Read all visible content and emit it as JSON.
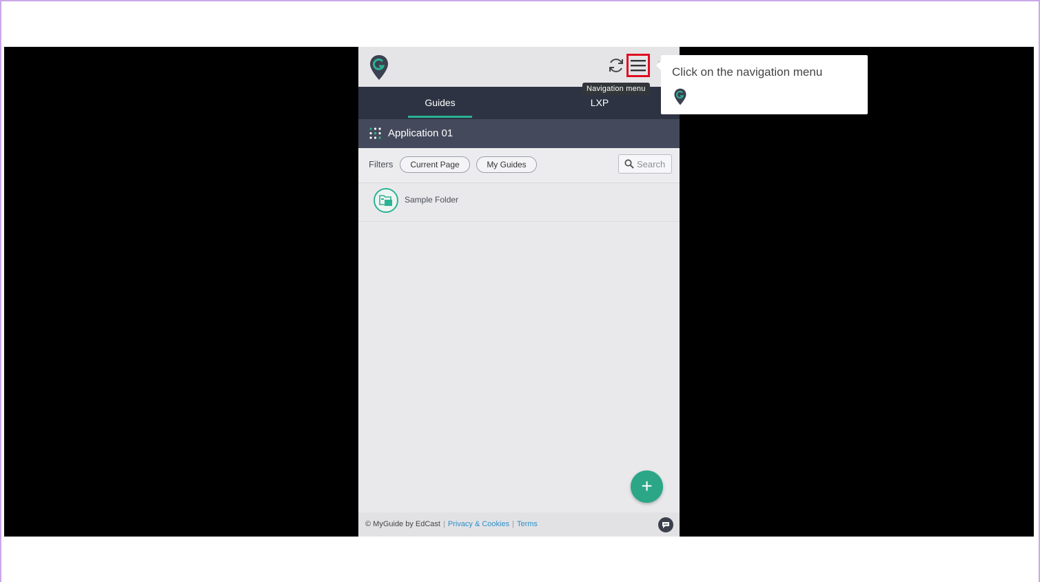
{
  "colors": {
    "accent": "#2bb394",
    "header_dark": "#2d3343",
    "app_bar": "#444a5b",
    "highlight": "#e00d1f",
    "link": "#2d8fc7"
  },
  "header": {
    "tooltip": "Navigation menu",
    "icons": [
      "myguide-logo-icon",
      "refresh-icon",
      "hamburger-menu-icon"
    ]
  },
  "tabs": [
    {
      "label": "Guides",
      "active": true
    },
    {
      "label": "LXP",
      "active": false
    }
  ],
  "app": {
    "title": "Application 01"
  },
  "filters": {
    "label": "Filters",
    "chips": [
      "Current Page",
      "My Guides"
    ],
    "search_placeholder": "Search"
  },
  "list": [
    {
      "label": "Sample Folder",
      "icon": "folder-icon"
    }
  ],
  "fab": {
    "label": "+"
  },
  "footer": {
    "copyright": "© MyGuide by EdCast",
    "privacy": "Privacy & Cookies",
    "terms": "Terms"
  },
  "callout": {
    "text": "Click on the navigation menu"
  }
}
